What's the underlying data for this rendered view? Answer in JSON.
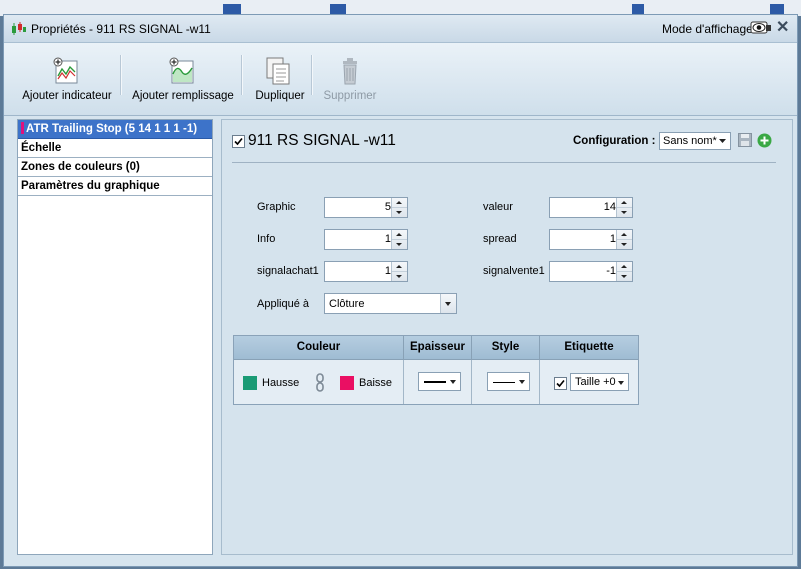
{
  "window": {
    "title": "Propriétés - 911 RS SIGNAL -w11",
    "mode_label": "Mode d'affichage",
    "close_glyph": "✕"
  },
  "toolbar": {
    "add_indicator": "Ajouter indicateur",
    "add_fill": "Ajouter remplissage",
    "duplicate": "Dupliquer",
    "delete": "Supprimer"
  },
  "sidebar": {
    "items": [
      {
        "label": "ATR Trailing Stop (5 14 1 1 1 -1)",
        "selected": true
      },
      {
        "label": "Échelle",
        "selected": false
      },
      {
        "label": "Zones de couleurs (0)",
        "selected": false
      },
      {
        "label": "Paramètres du graphique",
        "selected": false
      }
    ]
  },
  "indicator": {
    "name": "911 RS SIGNAL -w11",
    "enabled": true,
    "config_label": "Configuration :",
    "config_value": "Sans nom*"
  },
  "params": {
    "graphic": {
      "label": "Graphic",
      "value": "5"
    },
    "info": {
      "label": "Info",
      "value": "1"
    },
    "signalachat1": {
      "label": "signalachat1",
      "value": "1"
    },
    "valeur": {
      "label": "valeur",
      "value": "14"
    },
    "spread": {
      "label": "spread",
      "value": "1"
    },
    "signalvente1": {
      "label": "signalvente1",
      "value": "-1"
    },
    "applied_label": "Appliqué à",
    "applied_value": "Clôture"
  },
  "style_table": {
    "headers": {
      "color": "Couleur",
      "thickness": "Epaisseur",
      "style": "Style",
      "label": "Etiquette"
    },
    "up_label": "Hausse",
    "down_label": "Baisse",
    "up_color": "#1a9b75",
    "down_color": "#ea0f63",
    "label_enabled": true,
    "label_size": "Taille +0"
  },
  "colors": {
    "selection": "#3d73c9",
    "panel_bg": "#d5e3ed",
    "add_green": "#3aa845"
  }
}
